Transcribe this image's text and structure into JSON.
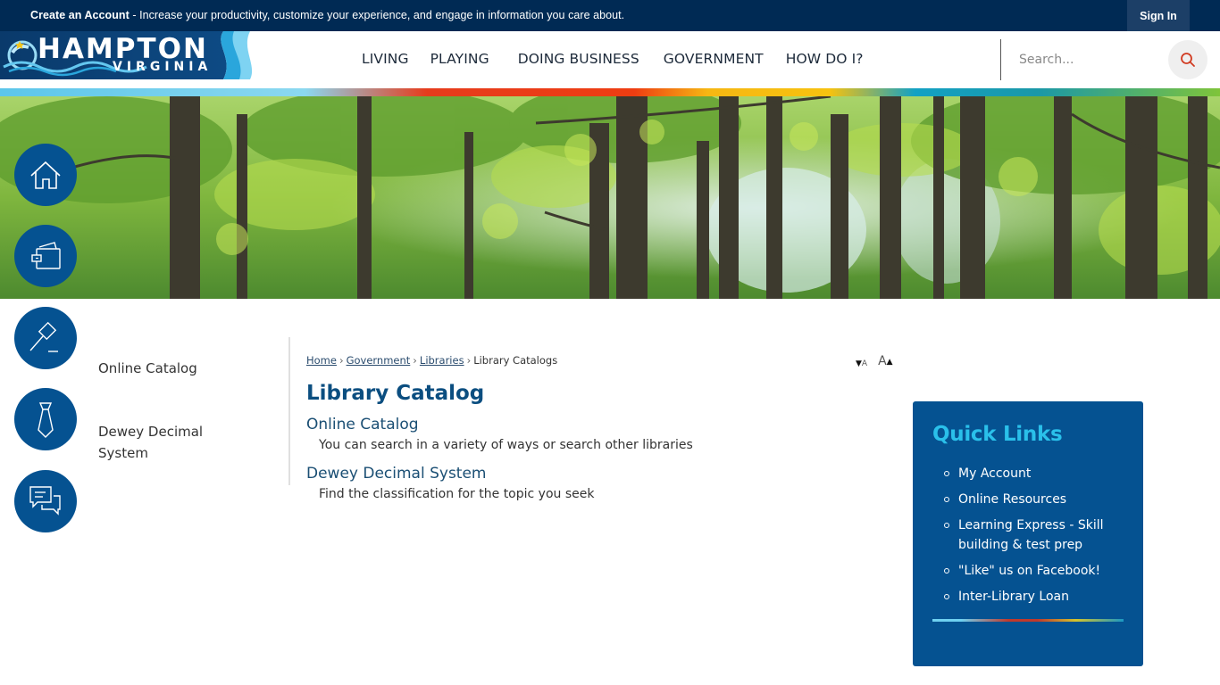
{
  "topbar": {
    "promo_link": "Create an Account",
    "promo_text": " - Increase your productivity, customize your experience, and engage in information you care about.",
    "signin_label": "Sign In"
  },
  "header": {
    "logo_main": "HAMPTON",
    "logo_sub": "VIRGINIA",
    "nav": [
      "LIVING",
      "PLAYING",
      "DOING BUSINESS",
      "GOVERNMENT",
      "HOW DO I?"
    ],
    "search": {
      "placeholder": "Search...",
      "value": "",
      "icon": "search-icon"
    }
  },
  "colors": {
    "topbar_bg": "#002a54",
    "brand_blue": "#055291",
    "title_blue": "#0b4e80",
    "quicklinks_heading": "#2ac0ea",
    "search_icon": "#d13b21"
  },
  "circle_nav": [
    {
      "icon": "home-icon",
      "label": "Home"
    },
    {
      "icon": "wallet-icon",
      "label": "Payments"
    },
    {
      "icon": "gavel-icon",
      "label": "Government"
    },
    {
      "icon": "necktie-icon",
      "label": "Business"
    },
    {
      "icon": "chat-bubbles-icon",
      "label": "Contact"
    }
  ],
  "subnav": {
    "items": [
      "Online Catalog",
      "Dewey Decimal System"
    ]
  },
  "breadcrumb": {
    "links": [
      "Home",
      "Government",
      "Libraries"
    ],
    "current": "Library Catalogs",
    "separator": "›"
  },
  "text_resize": {
    "decrease": "A",
    "increase": "A"
  },
  "content": {
    "title": "Library Catalog",
    "entries": [
      {
        "title": "Online Catalog",
        "description": "You can search in a variety of ways or search other libraries"
      },
      {
        "title": "Dewey Decimal System",
        "description": "Find the classification for the topic you seek"
      }
    ]
  },
  "quick_links": {
    "heading": "Quick Links",
    "items": [
      "My Account",
      "Online Resources",
      "Learning Express - Skill building & test prep",
      "\"Like\" us on Facebook!",
      "Inter-Library Loan"
    ]
  }
}
